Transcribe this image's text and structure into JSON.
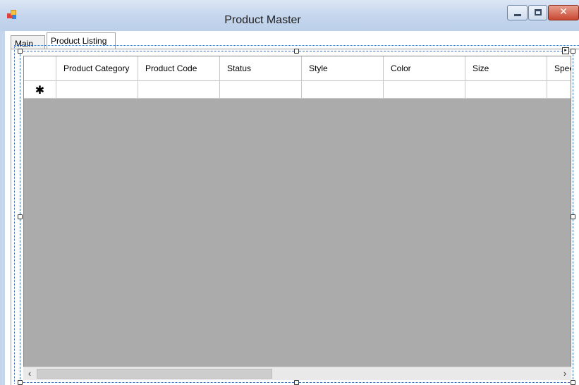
{
  "window": {
    "title": "Product Master",
    "controls": {
      "minimize_icon": "minimize-icon",
      "maximize_icon": "maximize-icon",
      "close_icon": "close-icon",
      "close_glyph": "✕"
    }
  },
  "tabs": [
    {
      "label": "Main",
      "selected": false
    },
    {
      "label": "Product Listing",
      "selected": true
    }
  ],
  "grid": {
    "columns": [
      "Product Category",
      "Product Code",
      "Status",
      "Style",
      "Color",
      "Size",
      "Specs"
    ],
    "new_row_marker": "✱",
    "background_color": "#ababab"
  },
  "scrollbar": {
    "left_arrow": "‹",
    "right_arrow": "›"
  }
}
